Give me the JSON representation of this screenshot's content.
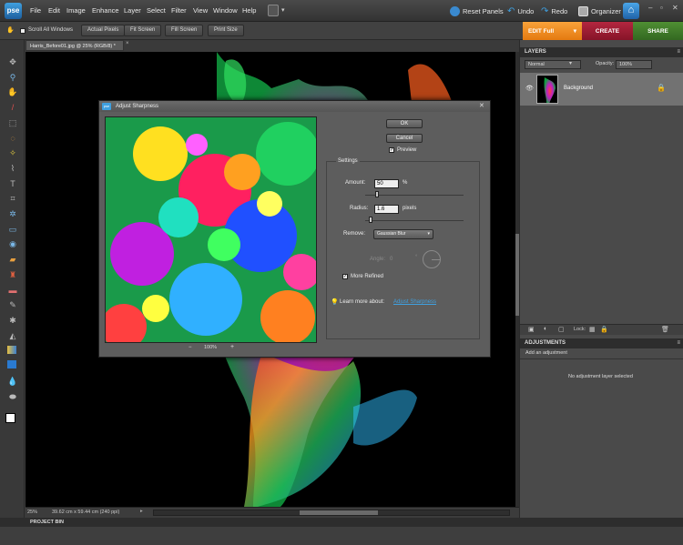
{
  "app": {
    "logo": "pse"
  },
  "menu": [
    "File",
    "Edit",
    "Image",
    "Enhance",
    "Layer",
    "Select",
    "Filter",
    "View",
    "Window",
    "Help"
  ],
  "topbar": {
    "reset_panels": "Reset Panels",
    "undo": "Undo",
    "redo": "Redo",
    "organizer": "Organizer"
  },
  "options": {
    "scroll_all": "Scroll All Windows",
    "actual_pixels": "Actual Pixels",
    "fit_screen": "Fit Screen",
    "fill_screen": "Fill Screen",
    "print_size": "Print Size"
  },
  "modes": {
    "edit": "EDIT Full",
    "create": "CREATE",
    "share": "SHARE"
  },
  "document": {
    "tab": "Harris_Before01.jpg @ 25% (RGB/8) *",
    "close": "×"
  },
  "layers": {
    "title": "LAYERS",
    "blend_mode": "Normal",
    "opacity_label": "Opacity:",
    "opacity_value": "100%",
    "layer_name": "Background",
    "lock_label": "Lock:"
  },
  "adjustments": {
    "title": "ADJUSTMENTS",
    "add": "Add an adjustment",
    "none": "No adjustment layer selected"
  },
  "status": {
    "zoom": "25%",
    "size": "39.62 cm x 59.44 cm (240 ppi)"
  },
  "project_bin": "PROJECT BIN",
  "dialog": {
    "title": "Adjust Sharpness",
    "ok": "OK",
    "cancel": "Cancel",
    "preview": "Preview",
    "settings": "Settings",
    "amount_label": "Amount:",
    "amount_value": "50",
    "amount_unit": "%",
    "radius_label": "Radius:",
    "radius_value": "1.6",
    "radius_unit": "pixels",
    "remove_label": "Remove:",
    "remove_value": "Gaussian Blur",
    "angle_label": "Angle:",
    "angle_value": "0",
    "more_refined": "More Refined",
    "learn_more": "Learn more about:",
    "learn_link": "Adjust Sharpness",
    "zoom_minus": "−",
    "zoom_value": "100%",
    "zoom_plus": "+"
  },
  "colors": {
    "edit_tab": "#f08a1c",
    "create_tab": "#9b1c34",
    "share_tab": "#3f7a2a",
    "accent": "#3fa0e0"
  }
}
